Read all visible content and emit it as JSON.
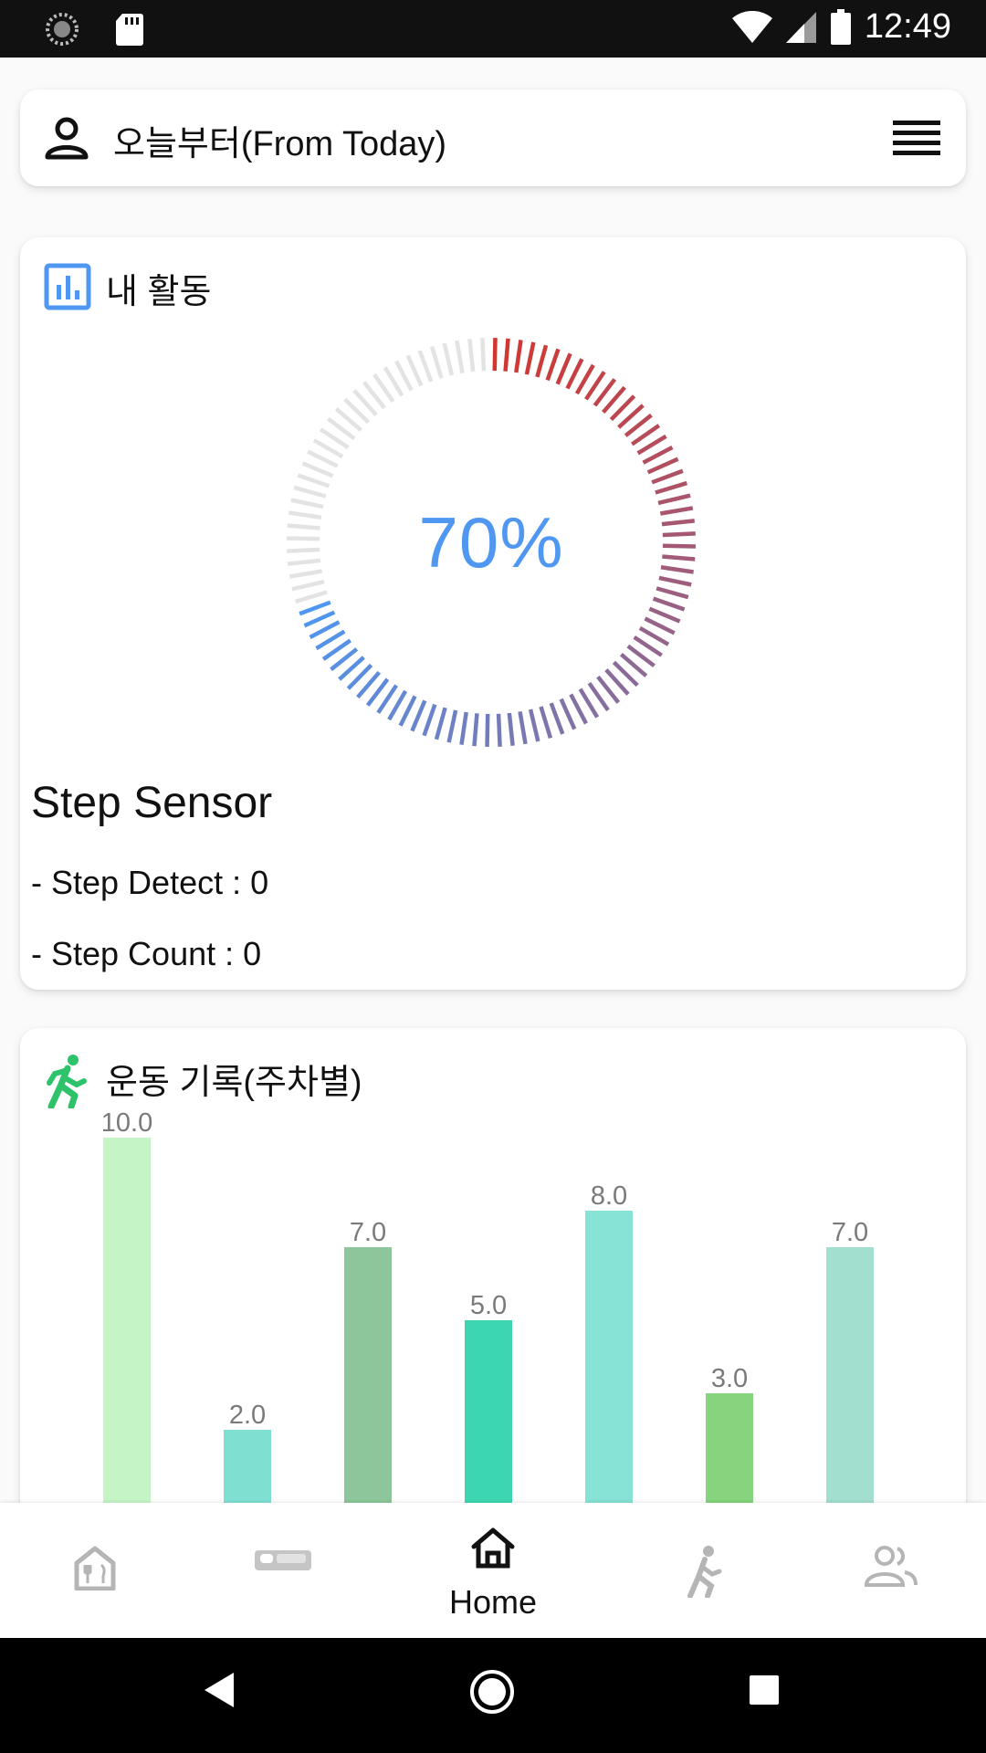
{
  "status_bar": {
    "time": "12:49"
  },
  "app_bar": {
    "title": "오늘부터(From Today)"
  },
  "activity": {
    "title": "내 활동",
    "progress_percent": 70,
    "progress_label": "70%",
    "sensor_title": "Step Sensor",
    "step_detect": "- Step Detect : 0",
    "step_count": "- Step Count : 0"
  },
  "exercise": {
    "title": "운동 기록(주차별)"
  },
  "chart_data": {
    "type": "bar",
    "values": [
      10.0,
      2.0,
      7.0,
      5.0,
      8.0,
      3.0,
      7.0
    ],
    "value_labels": [
      "10.0",
      "2.0",
      "7.0",
      "5.0",
      "8.0",
      "3.0",
      "7.0"
    ],
    "colors": [
      "#c5f5c6",
      "#7fe0d2",
      "#8cc69a",
      "#3dd6b3",
      "#86e3d5",
      "#86d47e",
      "#a3dfcf"
    ],
    "ylim": [
      0,
      10.0
    ]
  },
  "bottom_nav": {
    "items": [
      {
        "icon": "restaurant-icon",
        "label": ""
      },
      {
        "icon": "bed-icon",
        "label": ""
      },
      {
        "icon": "home-icon",
        "label": "Home"
      },
      {
        "icon": "walk-icon",
        "label": ""
      },
      {
        "icon": "people-icon",
        "label": ""
      }
    ]
  },
  "colors": {
    "gauge_start": "#d3362f",
    "gauge_end": "#4f97f0",
    "gauge_empty": "#e3e3e3",
    "accent": "#4f97f0",
    "walk_icon": "#2ec36a"
  }
}
